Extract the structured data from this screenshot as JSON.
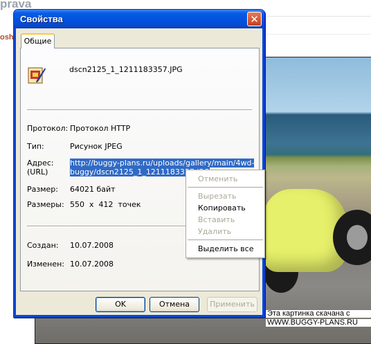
{
  "background": {
    "site_title": "prava",
    "side_label": "osh",
    "caption_line1": "Эта картинка скачана с",
    "caption_line2": "WWW.BUGGY-PLANS.RU"
  },
  "dialog": {
    "title": "Свойства",
    "close_glyph": "✕",
    "tab_label": "Общие",
    "file_name": "dscn2125_1_1211183357.JPG",
    "fields": {
      "protocol_label": "Протокол:",
      "protocol_value": "Протокол HTTP",
      "type_label": "Тип:",
      "type_value": "Рисунок JPEG",
      "address_label_line1": "Адрес:",
      "address_label_line2": "(URL)",
      "address_line1": "http://buggy-plans.ru/uploads/gallery/main/4wd-",
      "address_line2": "buggy/dscn2125_1_1211183357.JPG",
      "size_label": "Размер:",
      "size_value": "64021 байт",
      "dimensions_label": "Размеры:",
      "dimensions_value": "550  x  412  точек",
      "created_label": "Создан:",
      "created_value": "10.07.2008",
      "modified_label": "Изменен:",
      "modified_value": "10.07.2008"
    },
    "buttons": {
      "ok": "OK",
      "cancel": "Отмена",
      "apply": "Применить"
    }
  },
  "context_menu": {
    "items": [
      {
        "label": "Отменить",
        "enabled": false
      },
      {
        "label": "Вырезать",
        "enabled": false
      },
      {
        "label": "Копировать",
        "enabled": true
      },
      {
        "label": "Вставить",
        "enabled": false
      },
      {
        "label": "Удалить",
        "enabled": false
      },
      {
        "label": "Выделить все",
        "enabled": true
      }
    ]
  },
  "colors": {
    "title_bar": "#0052e0",
    "selection": "#316ac5",
    "dialog_face": "#ece9d8",
    "tab_highlight": "#ffc83c"
  }
}
